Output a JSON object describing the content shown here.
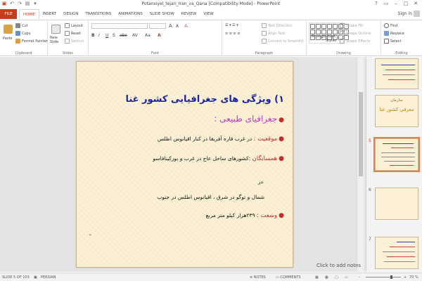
{
  "window": {
    "title": "Potansiyel_tejari_Iran_va_Qana [Compatibility Mode] - PowerPoint",
    "controls": [
      "?",
      "▭",
      "–",
      "□",
      "✕"
    ]
  },
  "tabs": [
    "FILE",
    "HOME",
    "INSERT",
    "DESIGN",
    "TRANSITIONS",
    "ANIMATIONS",
    "SLIDE SHOW",
    "REVIEW",
    "VIEW"
  ],
  "active_tab": "HOME",
  "signin": "Sign in",
  "ribbon": {
    "clipboard": {
      "label": "Clipboard",
      "paste": "Paste",
      "cut": "Cut",
      "copy": "Copy",
      "format_painter": "Format Painter"
    },
    "slides": {
      "label": "Slides",
      "new_slide": "New Slide",
      "layout": "Layout",
      "reset": "Reset",
      "section": "Section"
    },
    "font": {
      "label": "Font"
    },
    "paragraph": {
      "label": "Paragraph",
      "text_direction": "Text Direction",
      "align_text": "Align Text",
      "smartart": "Convert to SmartArt"
    },
    "drawing": {
      "label": "Drawing",
      "arrange": "Arrange",
      "quick_styles": "Quick Styles",
      "shape_fill": "Shape Fill",
      "shape_outline": "Shape Outline",
      "shape_effects": "Shape Effects"
    },
    "editing": {
      "label": "Editing",
      "find": "Find",
      "replace": "Replace",
      "select": "Select"
    }
  },
  "slide": {
    "title": "۱) ویژگی های جغرافیایی کشور غنا",
    "subtitle": "جغرافیای طبیعی :",
    "l1_label": "موقعیت :",
    "l1_text": " در غرب قاره آفریقا در کنار اقیانوس اطلس",
    "l2_label": "همسایگان",
    "l2_text": " :کشورهای ساحل عاج در غرب و بورکینافاسو",
    "l3_text": "در",
    "l4_text": "شمال و توگو در شرق ، اقیانوس اطلس در جنوب",
    "l5_label": "وسعت :",
    "l5_text": "۲۳۹هزار کیلو متر مربع",
    "mark": "\""
  },
  "notes_placeholder": "Click to add notes",
  "thumbnails": [
    {
      "num": "",
      "text": ""
    },
    {
      "num": "",
      "text": "معرفی کشور غنا",
      "text2": "سازمان"
    },
    {
      "num": "5",
      "text": ""
    },
    {
      "num": "6",
      "text": ""
    },
    {
      "num": "7",
      "text": ""
    }
  ],
  "status": {
    "slide_info": "SLIDE 5 OF 103",
    "language": "PERSIAN",
    "notes": "NOTES",
    "comments": "COMMENTS",
    "zoom": "70 %"
  }
}
